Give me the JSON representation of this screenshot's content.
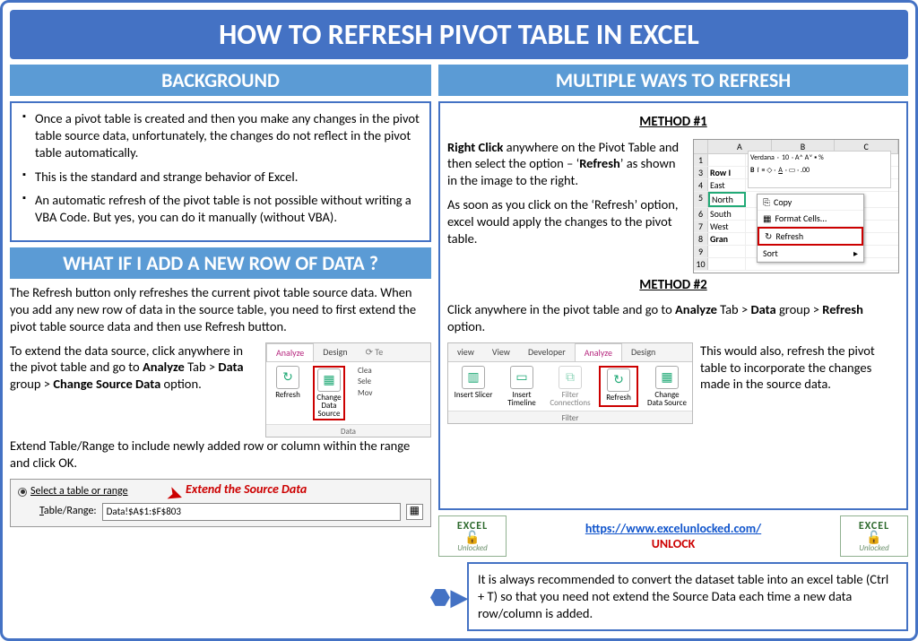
{
  "main_title": "HOW TO REFRESH PIVOT TABLE IN EXCEL",
  "left": {
    "background_header": "BACKGROUND",
    "bullets": [
      "Once a pivot table is created and then you make any changes in the pivot table source data, unfortunately, the changes do not reflect in the pivot table automatically.",
      "This is the standard and strange behavior of Excel.",
      "An automatic refresh of the pivot table is not possible without writing a VBA Code. But yes, you can do it manually (without VBA)."
    ],
    "newrow_header": "WHAT IF I ADD A NEW ROW OF DATA ?",
    "newrow_p1": "The Refresh button only refreshes the current pivot table source data. When you add any new row of data in the source table, you need to first extend the pivot table source data and then use Refresh button.",
    "newrow_p2a": "To extend the data source, click anywhere in the pivot table and go to ",
    "newrow_p2b": "Analyze",
    "newrow_p2c": " Tab > ",
    "newrow_p2d": "Data",
    "newrow_p2e": " group > ",
    "newrow_p2f": "Change Source Data",
    "newrow_p2g": " option.",
    "newrow_p3": "Extend Table/Range to include newly added row or column within the range and click OK.",
    "dialog": {
      "radio_label": "Select a table or range",
      "field_label": "Table/Range:",
      "field_value": "Data!$A$1:$F$803",
      "annotation": "Extend the Source Data"
    },
    "ribbon_small": {
      "tabs": [
        "Analyze",
        "Design"
      ],
      "buttons": [
        {
          "label": "Refresh"
        },
        {
          "label": "Change Data Source"
        }
      ],
      "side_items": [
        "Clea",
        "Sele",
        "Mov"
      ],
      "group": "Data"
    }
  },
  "right": {
    "header": "MULTIPLE WAYS TO REFRESH",
    "method1_label": "METHOD #1",
    "method1_p1a": "Right Click",
    "method1_p1b": " anywhere on the Pivot Table and then select the option – ‘",
    "method1_p1c": "Refresh",
    "method1_p1d": "’ as shown in the image to the right.",
    "method1_p2": "As soon as you click on the ‘Refresh’ option, excel would apply the changes to the pivot table.",
    "excel1": {
      "cols": [
        "A",
        "B",
        "C"
      ],
      "rows": [
        {
          "n": "1",
          "a": ""
        },
        {
          "n": "3",
          "a": "Row I"
        },
        {
          "n": "4",
          "a": "East"
        },
        {
          "n": "5",
          "a": "North"
        },
        {
          "n": "6",
          "a": "South"
        },
        {
          "n": "7",
          "a": "West"
        },
        {
          "n": "8",
          "a": "Gran"
        },
        {
          "n": "9",
          "a": ""
        },
        {
          "n": "10",
          "a": ""
        }
      ],
      "toolbar_font": "Verdana",
      "toolbar_size": "10",
      "ctx_items": [
        "Copy",
        "Format Cells...",
        "Refresh",
        "Sort"
      ]
    },
    "method2_label": "METHOD #2",
    "method2_p1a": "Click anywhere in the pivot table and go to ",
    "method2_p1b": "Analyze",
    "method2_p1c": " Tab > ",
    "method2_p1d": "Data",
    "method2_p1e": " group > ",
    "method2_p1f": "Refresh",
    "method2_p1g": " option.",
    "method2_p2": "This would also, refresh the pivot table to incorporate the changes made in the source data.",
    "ribbon": {
      "tabs": [
        "view",
        "View",
        "Developer",
        "Analyze",
        "Design"
      ],
      "buttons": [
        {
          "label": "Insert Slicer"
        },
        {
          "label": "Insert Timeline"
        },
        {
          "label": "Filter Connections"
        },
        {
          "label": "Refresh"
        },
        {
          "label": "Change Data Source"
        }
      ],
      "group": "Filter"
    }
  },
  "footer": {
    "logo_top": "EXCEL",
    "logo_bottom": "Unlocked",
    "url": "https://www.excelunlocked.com/",
    "unlock": "UNLOCK",
    "tip": "It is always recommended to convert the dataset table into an excel table (Ctrl + T) so that you need not extend the Source Data each time a new data row/column is added."
  }
}
